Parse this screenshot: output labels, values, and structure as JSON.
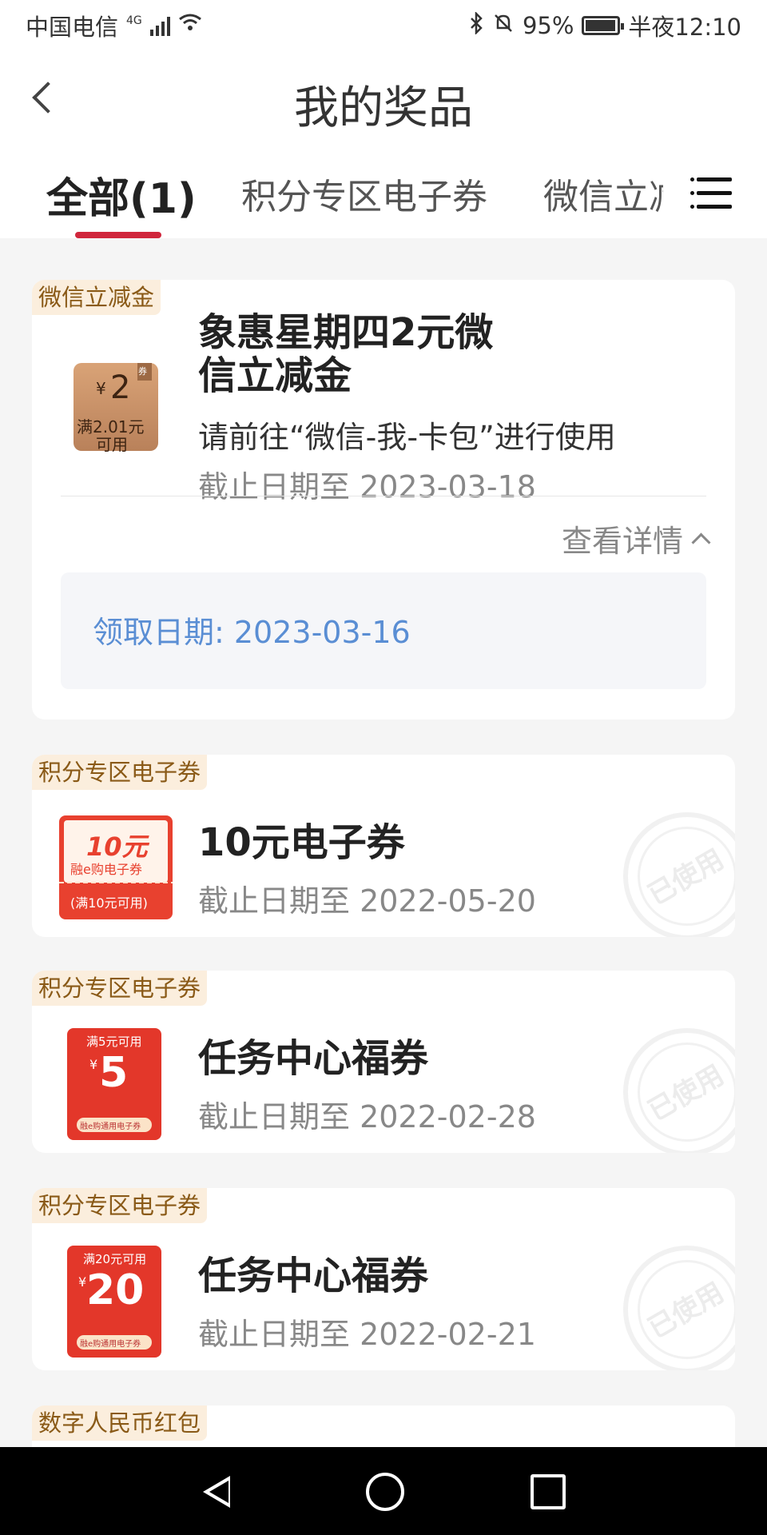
{
  "status": {
    "carrier": "中国电信",
    "network": "4G",
    "battery": "95%",
    "time": "半夜12:10"
  },
  "header": {
    "title": "我的奖品"
  },
  "tabs": [
    {
      "label": "全部(1)",
      "active": true
    },
    {
      "label": "积分专区电子券",
      "active": false
    },
    {
      "label": "微信立减",
      "active": false
    }
  ],
  "cards": [
    {
      "tag": "微信立减金",
      "title_line1": "象惠星期四2元微",
      "title_line2": "信立减金",
      "desc": "请前往“微信-我-卡包”进行使用",
      "date": "截止日期至 2023-03-18",
      "details_label": "查看详情",
      "receive_date": "领取日期: 2023-03-16",
      "ticket": {
        "amount": "2",
        "currency": "¥",
        "cond1": "满2.01元",
        "cond2": "可用",
        "mark": "券"
      }
    },
    {
      "tag": "积分专区电子券",
      "title": "10元电子券",
      "date": "截止日期至 2022-05-20",
      "stamp": "已使用",
      "ticket": {
        "amount": "10元",
        "sub": "融e购电子券",
        "cond": "(满10元可用)"
      }
    },
    {
      "tag": "积分专区电子券",
      "title": "任务中心福券",
      "date": "截止日期至 2022-02-28",
      "stamp": "已使用",
      "ticket": {
        "top": "满5元可用",
        "currency": "¥",
        "amount": "5",
        "bottom": "融e购通用电子券"
      }
    },
    {
      "tag": "积分专区电子券",
      "title": "任务中心福券",
      "date": "截止日期至 2022-02-21",
      "stamp": "已使用",
      "ticket": {
        "top": "满20元可用",
        "currency": "¥",
        "amount": "20",
        "bottom": "融e购通用电子券"
      }
    },
    {
      "tag": "数字人民币红包"
    }
  ],
  "colors": {
    "accent": "#d0263c",
    "tag_bg": "#fbeedd",
    "tag_text": "#8a5a17",
    "link_blue": "#5a8ed4"
  }
}
